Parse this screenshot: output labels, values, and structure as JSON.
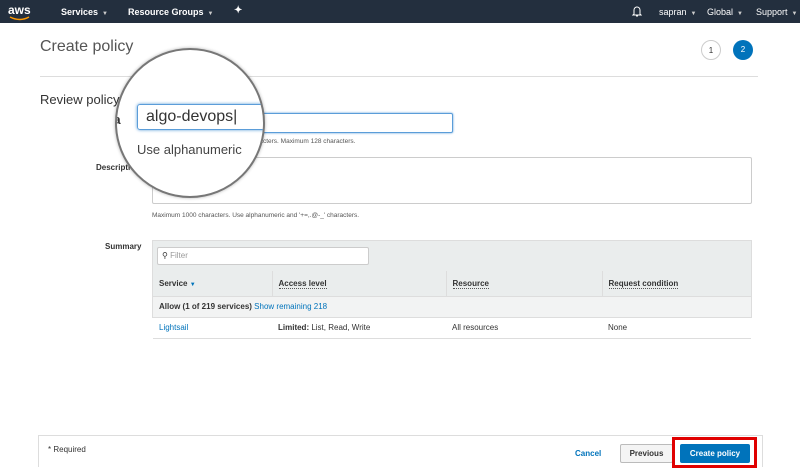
{
  "nav": {
    "logo": "aws",
    "services": "Services",
    "resource_groups": "Resource Groups",
    "user": "sapran",
    "region": "Global",
    "support": "Support"
  },
  "page": {
    "title": "Create policy",
    "steps": [
      "1",
      "2"
    ],
    "current_step": "2"
  },
  "review": {
    "heading": "Review policy",
    "name_label": "Name*",
    "name_value": "algo-devops",
    "name_hint": "Use alphanumeric and '+=,.@-_' characters. Maximum 128 characters.",
    "description_label": "Description",
    "description_value": "",
    "description_hint": "Maximum 1000 characters. Use alphanumeric and '+=,.@-_' characters.",
    "magnifier": {
      "name_value": "algo-devops",
      "hint": "Use alphanumeric",
      "label_fragment": "Na"
    }
  },
  "summary": {
    "label": "Summary",
    "filter_placeholder": "Filter",
    "columns": [
      "Service",
      "Access level",
      "Resource",
      "Request condition"
    ],
    "group": {
      "text": "Allow (1 of 219 services)",
      "link": "Show remaining 218"
    },
    "rows": [
      {
        "service": "Lightsail",
        "access_bold": "Limited:",
        "access": " List, Read, Write",
        "resource": "All resources",
        "condition": "None"
      }
    ]
  },
  "footer": {
    "required": "* Required",
    "cancel": "Cancel",
    "previous": "Previous",
    "create": "Create policy"
  },
  "colors": {
    "nav": "#232f3e",
    "primary": "#0073bb",
    "highlight": "#e00000"
  }
}
